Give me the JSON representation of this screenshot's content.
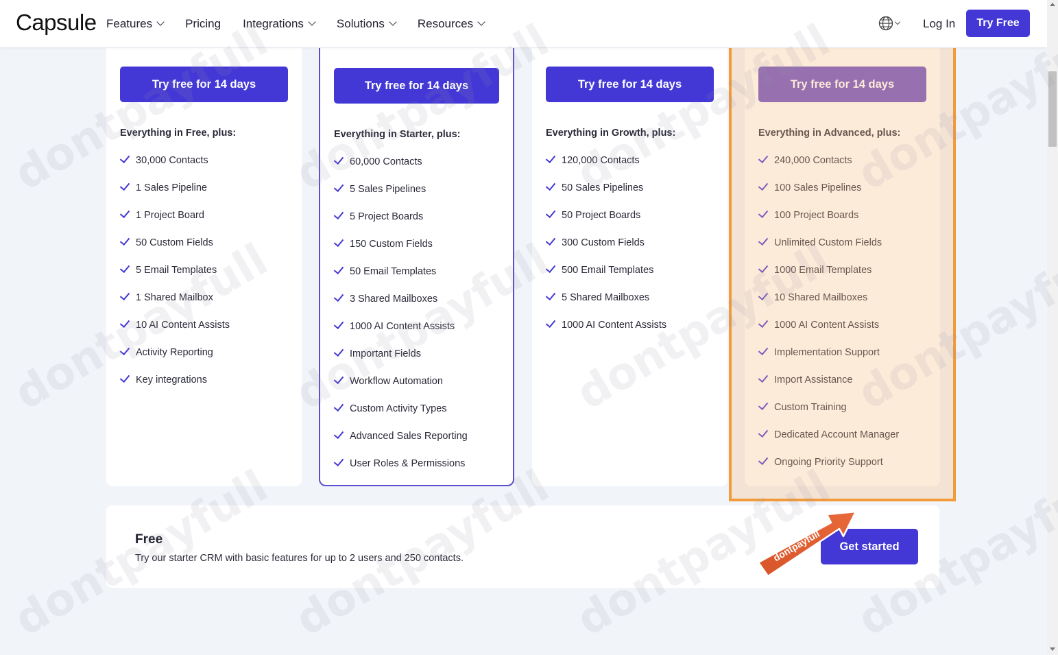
{
  "header": {
    "logo": "Capsule",
    "nav": [
      {
        "label": "Features",
        "dropdown": true
      },
      {
        "label": "Pricing",
        "dropdown": false
      },
      {
        "label": "Integrations",
        "dropdown": true
      },
      {
        "label": "Solutions",
        "dropdown": true
      },
      {
        "label": "Resources",
        "dropdown": true
      }
    ],
    "login_label": "Log In",
    "try_free_label": "Try Free"
  },
  "plans": [
    {
      "cta": "Try free for 14 days",
      "plus": "Everything in Free, plus:",
      "features": [
        "30,000 Contacts",
        "1 Sales Pipeline",
        "1 Project Board",
        "50 Custom Fields",
        "5 Email Templates",
        "1 Shared Mailbox",
        "10 AI Content Assists",
        "Activity Reporting",
        "Key integrations"
      ]
    },
    {
      "cta": "Try free for 14 days",
      "plus": "Everything in Starter, plus:",
      "features": [
        "60,000 Contacts",
        "5 Sales Pipelines",
        "5 Project Boards",
        "150 Custom Fields",
        "50 Email Templates",
        "3 Shared Mailboxes",
        "1000 AI Content Assists",
        "Important Fields",
        "Workflow Automation",
        "Custom Activity Types",
        "Advanced Sales Reporting",
        "User Roles & Permissions"
      ]
    },
    {
      "cta": "Try free for 14 days",
      "plus": "Everything in Growth, plus:",
      "features": [
        "120,000 Contacts",
        "50 Sales Pipelines",
        "50 Project Boards",
        "300 Custom Fields",
        "500 Email Templates",
        "5 Shared Mailboxes",
        "1000 AI Content Assists"
      ]
    },
    {
      "cta": "Try free for 14 days",
      "plus": "Everything in Advanced, plus:",
      "features": [
        "240,000 Contacts",
        "100 Sales Pipelines",
        "100 Project Boards",
        "Unlimited Custom Fields",
        "1000 Email Templates",
        "10 Shared Mailboxes",
        "1000 AI Content Assists",
        "Implementation Support",
        "Import Assistance",
        "Custom Training",
        "Dedicated Account Manager",
        "Ongoing Priority Support"
      ]
    }
  ],
  "free_plan": {
    "title": "Free",
    "description": "Try our starter CRM with basic features for up to 2 users and 250 contacts.",
    "cta": "Get started"
  },
  "annotation": {
    "arrow_text": "dontpayfull",
    "highlight_color": "#f39a3a"
  },
  "watermark_text": "dontpayfull",
  "colors": {
    "primary": "#4338d6",
    "highlighted_cta": "#6e4fc4",
    "featured_border": "#5a4fd0",
    "background": "#f1f4f9"
  }
}
